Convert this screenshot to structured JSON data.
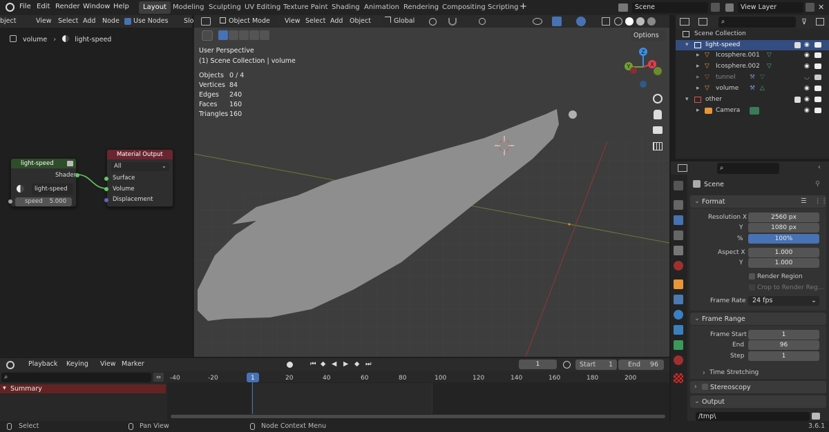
{
  "menus": [
    "File",
    "Edit",
    "Render",
    "Window",
    "Help"
  ],
  "workspaces": [
    "Layout",
    "Modeling",
    "Sculpting",
    "UV Editing",
    "Texture Paint",
    "Shading",
    "Animation",
    "Rendering",
    "Compositing",
    "Scripting"
  ],
  "scene_name": "Scene",
  "view_layer": "View Layer",
  "node_editor": {
    "object_menu": "bject",
    "menu_items": [
      "View",
      "Select",
      "Add",
      "Node"
    ],
    "use_nodes_label": "Use Nodes",
    "slot_label": "Slo",
    "breadcrumb": [
      "volume",
      "light-speed"
    ],
    "group_node": {
      "title": "light-speed",
      "output": "Shader",
      "material": "light-speed",
      "param_label": "speed",
      "param_value": "5.000"
    },
    "output_node": {
      "title": "Material Output",
      "target": "All",
      "inputs": [
        "Surface",
        "Volume",
        "Displacement"
      ]
    }
  },
  "viewport": {
    "mode": "Object Mode",
    "menu_items": [
      "View",
      "Select",
      "Add",
      "Object"
    ],
    "orientation": "Global",
    "options_label": "Options",
    "perspective": "User Perspective",
    "collection_line": "(1) Scene Collection | volume",
    "stats": [
      {
        "label": "Objects",
        "value": "0 / 4"
      },
      {
        "label": "Vertices",
        "value": "84"
      },
      {
        "label": "Edges",
        "value": "240"
      },
      {
        "label": "Faces",
        "value": "160"
      },
      {
        "label": "Triangles",
        "value": "160"
      }
    ],
    "gizmo": {
      "z": "Z",
      "y": "Y",
      "x": "X"
    }
  },
  "outliner": {
    "root": "Scene Collection",
    "items": [
      {
        "label": "light-speed",
        "level": 0
      },
      {
        "label": "Icosphere.001",
        "level": 1
      },
      {
        "label": "Icosphere.002",
        "level": 1
      },
      {
        "label": "tunnel",
        "level": 1
      },
      {
        "label": "volume",
        "level": 1
      },
      {
        "label": "other",
        "level": 0
      },
      {
        "label": "Camera",
        "level": 1
      }
    ]
  },
  "properties": {
    "context": "Scene",
    "format_panel": "Format",
    "resolution_x_label": "Resolution X",
    "resolution_x": "2560 px",
    "y_label": "Y",
    "resolution_y": "1080 px",
    "percent_label": "%",
    "percent": "100%",
    "aspect_x_label": "Aspect X",
    "aspect_x": "1.000",
    "aspect_y": "1.000",
    "render_region": "Render Region",
    "crop_region": "Crop to Render Reg...",
    "frame_rate_label": "Frame Rate",
    "frame_rate": "24 fps",
    "frame_range_panel": "Frame Range",
    "frame_start_label": "Frame Start",
    "frame_start": "1",
    "end_label": "End",
    "end": "96",
    "step_label": "Step",
    "step": "1",
    "time_stretching": "Time Stretching",
    "stereoscopy": "Stereoscopy",
    "output_panel": "Output",
    "output_path": "/tmp\\"
  },
  "timeline": {
    "menu_items": [
      "Playback",
      "Keying",
      "View",
      "Marker"
    ],
    "current_frame": "1",
    "start_label": "Start",
    "start": "1",
    "end_label": "End",
    "end": "96",
    "summary": "Summary",
    "ticks": [
      "-40",
      "-20",
      "1",
      "20",
      "40",
      "60",
      "80",
      "100",
      "120",
      "140",
      "160",
      "180",
      "200"
    ]
  },
  "statusbar": {
    "select": "Select",
    "pan": "Pan View",
    "context": "Node Context Menu",
    "version": "3.6.1"
  },
  "colors": {
    "accent": "#4772b3",
    "header": "#2b2b2b",
    "nodehead_group": "#2f4d2a",
    "nodehead_output": "#6b2530",
    "socket_green": "#63c763",
    "socket_purple": "#6363c7"
  }
}
